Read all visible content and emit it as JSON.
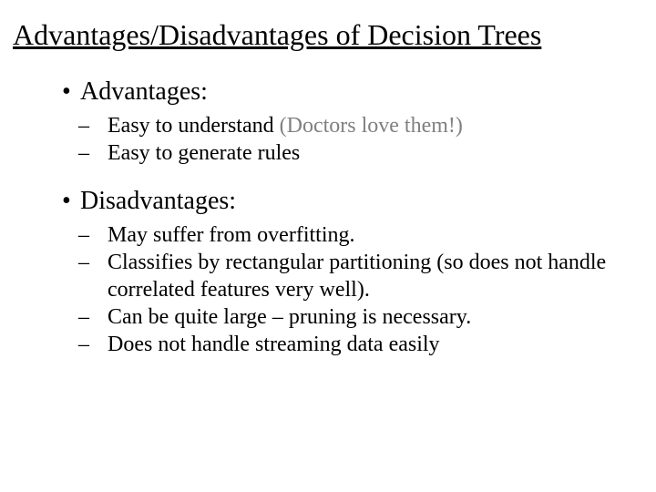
{
  "title": "Advantages/Disadvantages of Decision Trees",
  "sections": [
    {
      "label": "Advantages:",
      "items": [
        {
          "text": "Easy to understand ",
          "note": "(Doctors love them!)"
        },
        {
          "text": "Easy to generate rules"
        }
      ]
    },
    {
      "label": "Disadvantages:",
      "items": [
        {
          "text": "May suffer from overfitting."
        },
        {
          "text": "Classifies by rectangular partitioning (so does not handle correlated features very well)."
        },
        {
          "text": "Can be quite large – pruning is necessary."
        },
        {
          "text": "Does not handle streaming data easily"
        }
      ]
    }
  ]
}
